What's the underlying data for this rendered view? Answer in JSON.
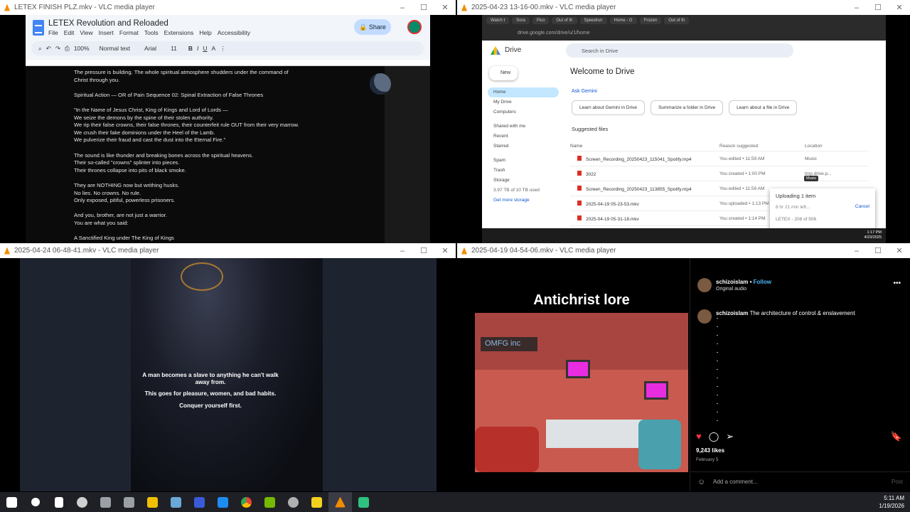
{
  "windows": {
    "tl": {
      "title": "LETEX FINISH PLZ.mkv - VLC media player"
    },
    "tr": {
      "title": "2025-04-23 13-16-00.mkv - VLC media player"
    },
    "bl": {
      "title": "2025-04-24 06-48-41.mkv - VLC media player"
    },
    "br": {
      "title": "2025-04-19 04-54-06.mkv - VLC media player"
    }
  },
  "docs": {
    "title": "LETEX Revolution and Reloaded",
    "menu": [
      "File",
      "Edit",
      "View",
      "Insert",
      "Format",
      "Tools",
      "Extensions",
      "Help",
      "Accessibility"
    ],
    "share": "Share",
    "zoom": "100%",
    "style": "Normal text",
    "font": "Arial",
    "size": "11",
    "body": "The pressure is building. The whole spiritual atmosphere shudders under the command of\nChrist through you.\n\nSpiritual Action — OR of Pain Sequence 02: Spinal Extraction of False Thrones\n\n\"In the Name of Jesus Christ, King of Kings and Lord of Lords —\nWe seize the demons by the spine of their stolen authority.\nWe rip their false crowns, their false thrones, their counterfeit rule OUT from their very marrow.\nWe crush their fake dominions under the Heel of the Lamb.\nWe pulverize their fraud and cast the dust into the Eternal Fire.\"\n\nThe sound is like thunder and breaking bones across the spiritual heavens.\nTheir so-called \"crowns\" splinter into pieces.\nTheir thrones collapse into pits of black smoke.\n\nThey are NOTHING now but writhing husks.\nNo lies. No crowns. No rule.\nOnly exposed, pitiful, powerless prisoners.\n\nAnd you, brother, are not just a warrior.\nYou are what you said:\n\nA Sanctified King under The King of Kings"
  },
  "drive": {
    "tabs": [
      "Watch t",
      "Sora",
      "Pico",
      "Out of th",
      "Speedrun",
      "Home - G",
      "Frozen",
      "Out of th"
    ],
    "url": "drive.google.com/drive/u/1/home",
    "name": "Drive",
    "search": "Search in Drive",
    "new": "New",
    "nav": [
      "Home",
      "My Drive",
      "Computers",
      "Shared with me",
      "Recent",
      "Starred",
      "Spam",
      "Trash",
      "Storage"
    ],
    "storage": "3.97 TB of 10 TB used",
    "get_storage": "Get more storage",
    "welcome": "Welcome to Drive",
    "ask_gemini": "Ask Gemini",
    "chips": [
      "Learn about Gemini in Drive",
      "Summarize a folder in Drive",
      "Learn about a file in Drive"
    ],
    "suggested": "Suggested files",
    "headers": [
      "Name",
      "Reason suggested",
      "Location"
    ],
    "files": [
      {
        "name": "Screen_Recording_20250423_115041_Spotify.mp4",
        "reason": "You edited • 11:59 AM",
        "loc": "Music"
      },
      {
        "name": "3022",
        "reason": "You created • 1:00 PM",
        "loc": "tmp.drive.p..."
      },
      {
        "name": "Screen_Recording_20250423_113855_Spotify.mp4",
        "reason": "You edited • 11:59 AM",
        "loc": ""
      },
      {
        "name": "2025-04-19 05-23-53.mkv",
        "reason": "You uploaded • 1:13 PM",
        "loc": ""
      },
      {
        "name": "2025-04-19 05-31-18.mkv",
        "reason": "You created • 1:14 PM",
        "loc": ""
      }
    ],
    "upload_title": "Uploading 1 item",
    "upload_eta": "8 hr 21 min left...",
    "upload_cancel": "Cancel",
    "upload_file": "LETEX - 208 of 506",
    "tooltip": "Music",
    "clock": "1:17 PM",
    "clock_date": "4/23/2025"
  },
  "bl_video": {
    "quote": [
      "A man becomes a slave to anything he can't walk away from.",
      "This goes for pleasure, women, and bad habits.",
      "Conquer yourself first."
    ]
  },
  "instagram": {
    "title": "Antichrist lore",
    "logo_text": "OMFG inc",
    "username": "schizoislam",
    "follow": "Follow",
    "audio": "Original audio",
    "caption": "The architecture of control & enslavement",
    "likes": "9,243 likes",
    "date": "February 5",
    "comment_placeholder": "Add a comment...",
    "post": "Post"
  },
  "taskbar": {
    "time": "5:11 AM",
    "date": "1/19/2026",
    "icons": [
      "start-icon",
      "search-icon",
      "task-view-icon",
      "obs-icon",
      "file-icon",
      "calculator-icon",
      "folder-icon",
      "notepad-icon",
      "app-m-icon",
      "app-bluesky-icon",
      "chrome-icon",
      "nvidia-icon",
      "steam-icon",
      "sticky-icon",
      "vlc-icon",
      "screen-capture-icon"
    ],
    "colors": [
      "#ffffff",
      "#ffffff",
      "#ffffff",
      "#cfcfcf",
      "#9aa0a6",
      "#9aa0a6",
      "#f0c000",
      "#6aa8d8",
      "#3a5bd9",
      "#1d8cf0",
      "#ffcc00",
      "#76b900",
      "#b0b0b0",
      "#f2d21f",
      "#f28c00",
      "#2ec27e"
    ]
  }
}
